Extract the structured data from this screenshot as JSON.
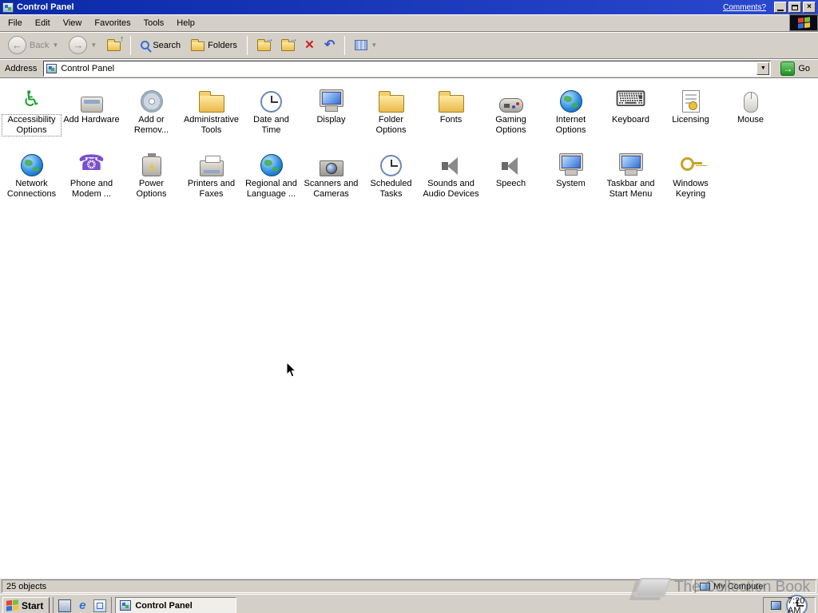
{
  "titlebar": {
    "title": "Control Panel",
    "comments_link": "Comments?"
  },
  "menubar": {
    "items": [
      "File",
      "Edit",
      "View",
      "Favorites",
      "Tools",
      "Help"
    ]
  },
  "toolbar": {
    "back_label": "Back",
    "search_label": "Search",
    "folders_label": "Folders"
  },
  "addressbar": {
    "label": "Address",
    "value": "Control Panel",
    "go_label": "Go"
  },
  "content": {
    "items": [
      {
        "label": "Accessibility Options",
        "icon": "accessibility-options-icon",
        "shape": "glyph",
        "glyph": "♿",
        "color": "#1f9e2f",
        "selected": true
      },
      {
        "label": "Add Hardware",
        "icon": "add-hardware-icon",
        "shape": "device"
      },
      {
        "label": "Add or Remov...",
        "icon": "add-or-remove-programs-icon",
        "shape": "disc"
      },
      {
        "label": "Administrative Tools",
        "icon": "administrative-tools-icon",
        "shape": "folder"
      },
      {
        "label": "Date and Time",
        "icon": "date-and-time-icon",
        "shape": "clock"
      },
      {
        "label": "Display",
        "icon": "display-icon",
        "shape": "display"
      },
      {
        "label": "Folder Options",
        "icon": "folder-options-icon",
        "shape": "folder"
      },
      {
        "label": "Fonts",
        "icon": "fonts-icon",
        "shape": "folder"
      },
      {
        "label": "Gaming Options",
        "icon": "gaming-options-icon",
        "shape": "gamepad"
      },
      {
        "label": "Internet Options",
        "icon": "internet-options-icon",
        "shape": "globe"
      },
      {
        "label": "Keyboard",
        "icon": "keyboard-icon",
        "shape": "glyph",
        "glyph": "⌨",
        "color": "#4a4a4a"
      },
      {
        "label": "Licensing",
        "icon": "licensing-icon",
        "shape": "page"
      },
      {
        "label": "Mouse",
        "icon": "mouse-icon",
        "shape": "mouse"
      },
      {
        "label": "Network Connections",
        "icon": "network-connections-icon",
        "shape": "globe"
      },
      {
        "label": "Phone and Modem ...",
        "icon": "phone-and-modem-icon",
        "shape": "glyph",
        "glyph": "☎",
        "color": "#7a4fd0"
      },
      {
        "label": "Power Options",
        "icon": "power-options-icon",
        "shape": "power"
      },
      {
        "label": "Printers and Faxes",
        "icon": "printers-and-faxes-icon",
        "shape": "printer"
      },
      {
        "label": "Regional and Language ...",
        "icon": "regional-and-language-icon",
        "shape": "globe"
      },
      {
        "label": "Scanners and Cameras",
        "icon": "scanners-and-cameras-icon",
        "shape": "camera"
      },
      {
        "label": "Scheduled Tasks",
        "icon": "scheduled-tasks-icon",
        "shape": "clock"
      },
      {
        "label": "Sounds and Audio Devices",
        "icon": "sounds-and-audio-devices-icon",
        "shape": "speaker"
      },
      {
        "label": "Speech",
        "icon": "speech-icon",
        "shape": "speaker"
      },
      {
        "label": "System",
        "icon": "system-icon",
        "shape": "display"
      },
      {
        "label": "Taskbar and Start Menu",
        "icon": "taskbar-and-start-menu-icon",
        "shape": "display"
      },
      {
        "label": "Windows Keyring",
        "icon": "windows-keyring-icon",
        "shape": "key"
      }
    ]
  },
  "statusbar": {
    "object_count": "25 objects",
    "zone": "My Computer"
  },
  "taskbar": {
    "start_label": "Start",
    "task_button": "Control Panel",
    "clock": "7:20 AM"
  },
  "watermark": {
    "text": "The Collection Book"
  },
  "icons": {
    "back_arrow": "←",
    "forward_arrow": "→",
    "up_arrow": "↑",
    "dropdown_arrow": "▼",
    "combo_arrow": "▼",
    "delete_x": "×",
    "undo_arrow": "↶",
    "go_arrow": "→",
    "close": "×",
    "move_arrow": "→",
    "copy_arrow": "→",
    "ie_e": "e"
  },
  "colors": {
    "titlebar_blue": "#0A2AA8",
    "chrome_gray": "#D4D0C8",
    "go_green": "#1F8F1F",
    "delete_red": "#CC2222",
    "folder_yellow": "#E9B94E"
  }
}
